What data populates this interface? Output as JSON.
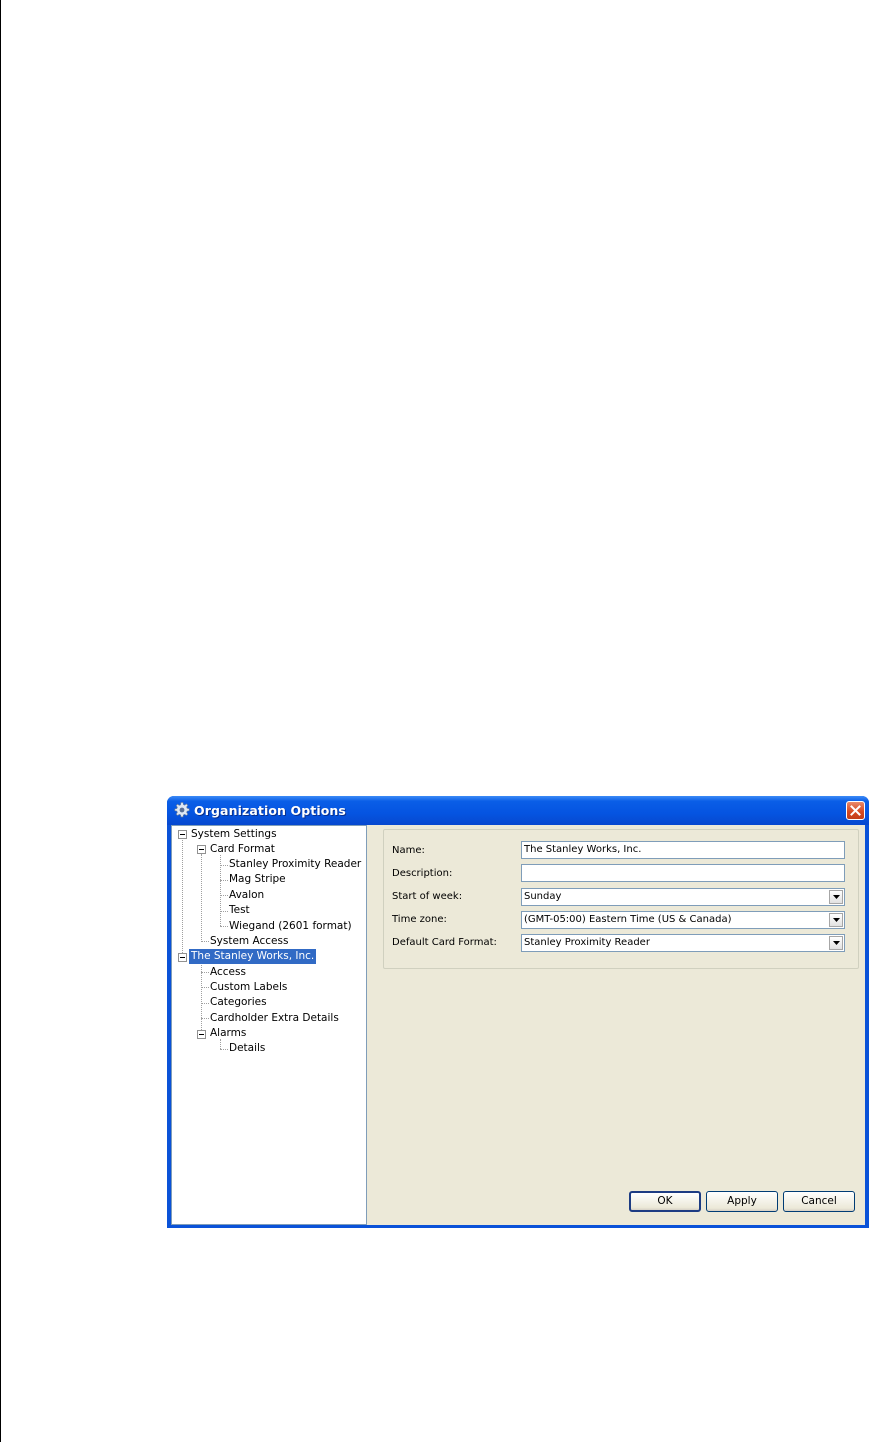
{
  "window": {
    "title": "Organization Options",
    "icon": "gear-icon",
    "accent": "#0554e1"
  },
  "tree": {
    "items": [
      {
        "label": "System Settings",
        "level": 0,
        "expanded": true
      },
      {
        "label": "Card Format",
        "level": 1,
        "expanded": true
      },
      {
        "label": "Stanley Proximity Reader",
        "level": 2
      },
      {
        "label": "Mag Stripe",
        "level": 2
      },
      {
        "label": "Avalon",
        "level": 2
      },
      {
        "label": "Test",
        "level": 2
      },
      {
        "label": "Wiegand (2601 format)",
        "level": 2
      },
      {
        "label": "System Access",
        "level": 1
      },
      {
        "label": "The Stanley Works, Inc.",
        "level": 0,
        "expanded": true,
        "selected": true
      },
      {
        "label": "Access",
        "level": 1
      },
      {
        "label": "Custom Labels",
        "level": 1
      },
      {
        "label": "Categories",
        "level": 1
      },
      {
        "label": "Cardholder Extra Details",
        "level": 1
      },
      {
        "label": "Alarms",
        "level": 1,
        "expanded": true
      },
      {
        "label": "Details",
        "level": 2
      }
    ]
  },
  "form": {
    "name_label": "Name:",
    "name_value": "The Stanley Works, Inc.",
    "description_label": "Description:",
    "description_value": "",
    "start_week_label": "Start of week:",
    "start_week_value": "Sunday",
    "timezone_label": "Time zone:",
    "timezone_value": "(GMT-05:00) Eastern Time (US & Canada)",
    "card_format_label": "Default Card Format:",
    "card_format_value": "Stanley Proximity Reader"
  },
  "buttons": {
    "ok": "OK",
    "apply": "Apply",
    "cancel": "Cancel"
  }
}
